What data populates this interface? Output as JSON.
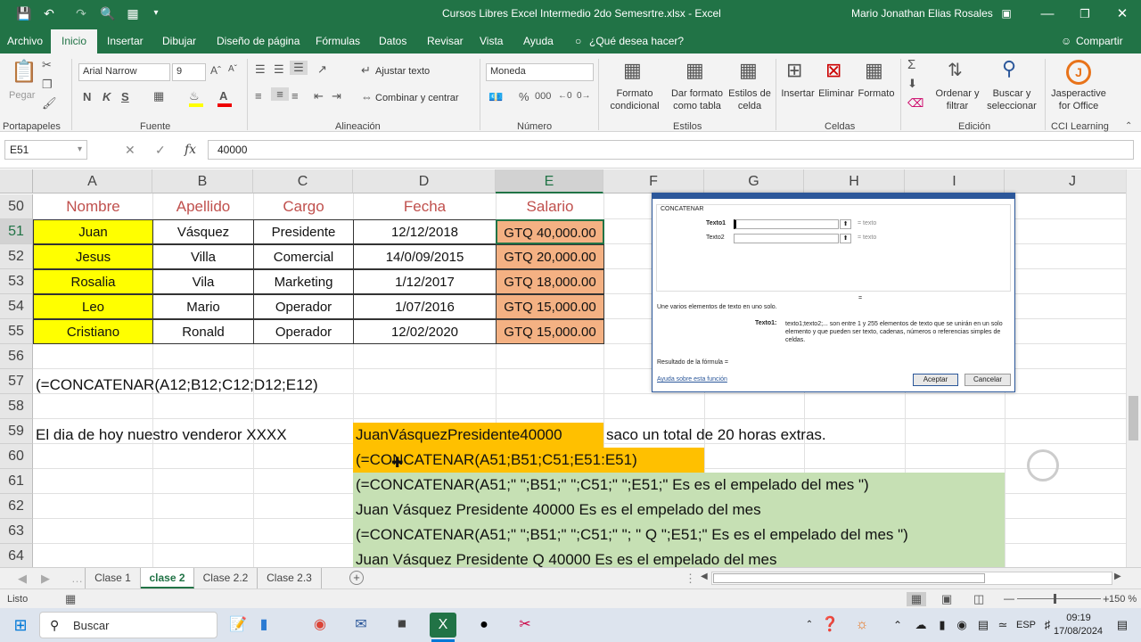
{
  "title_bar": {
    "file_title": "Cursos Libres Excel Intermedio 2do Semesrtre.xlsx  -  Excel",
    "user": "Mario Jonathan  Elias Rosales"
  },
  "tabs": [
    "Archivo",
    "Inicio",
    "Insertar",
    "Dibujar",
    "Diseño de página",
    "Fórmulas",
    "Datos",
    "Revisar",
    "Vista",
    "Ayuda"
  ],
  "tell_me": "¿Qué desea hacer?",
  "share": "Compartir",
  "ribbon": {
    "paste": "Pegar",
    "font_name": "Arial Narrow",
    "font_size": "9",
    "wrap_text": "Ajustar texto",
    "merge_center": "Combinar y centrar",
    "number_format": "Moneda",
    "cond_format": "Formato condicional",
    "format_table": "Dar formato como tabla",
    "cell_styles": "Estilos de celda",
    "insert": "Insertar",
    "delete": "Eliminar",
    "format": "Formato",
    "sort_filter": "Ordenar y filtrar",
    "find_select": "Buscar y seleccionar",
    "jasper": "Jasperactive for Office",
    "groups": [
      "Portapapeles",
      "Fuente",
      "Alineación",
      "Número",
      "Estilos",
      "Celdas",
      "Edición",
      "CCI Learning"
    ],
    "bold": "N",
    "italic": "K",
    "underline": "S"
  },
  "formula_bar": {
    "name_box": "E51",
    "fx": "fx",
    "content": "40000"
  },
  "columns": [
    "A",
    "B",
    "C",
    "D",
    "E",
    "F",
    "G",
    "H",
    "I",
    "J"
  ],
  "rows": [
    "50",
    "51",
    "52",
    "53",
    "54",
    "55",
    "56",
    "57",
    "58",
    "59",
    "60",
    "61",
    "62",
    "63",
    "64"
  ],
  "table": {
    "headers": [
      "Nombre",
      "Apellido",
      "Cargo",
      "Fecha",
      "Salario"
    ],
    "data": [
      [
        "Juan",
        "Vásquez",
        "Presidente",
        "12/12/2018",
        "GTQ 40,000.00"
      ],
      [
        "Jesus",
        "Villa",
        "Comercial",
        "14/0/09/2015",
        "GTQ 20,000.00"
      ],
      [
        "Rosalia",
        "Vila",
        "Marketing",
        "1/12/2017",
        "GTQ 18,000.00"
      ],
      [
        "Leo",
        "Mario",
        "Operador",
        "1/07/2016",
        "GTQ 15,000.00"
      ],
      [
        "Cristiano",
        "Ronald",
        "Operador",
        "12/02/2020",
        "GTQ 15,000.00"
      ]
    ]
  },
  "cells": {
    "r57": "(=CONCATENAR(A12;B12;C12;D12;E12)",
    "r59a": "El dia de hoy nuestro venderor XXXX",
    "r59d": "JuanVásquezPresidente40000",
    "r59f": "saco un total de 20 horas extras.",
    "r60d": "(=CONCATENAR(A51;B51;C51;E51:E51)",
    "r61": "(=CONCATENAR(A51;\" \";B51;\" \";C51;\" \";E51;\"  Es es el empelado del mes \")",
    "r62": "Juan Vásquez Presidente 40000  Es es el empelado del mes",
    "r63": "(=CONCATENAR(A51;\" \";B51;\" \";C51;\" \"; \" Q \";E51;\"  Es es el empelado del mes \")",
    "r64": "Juan Vásquez Presidente  Q 40000  Es es el empelado del mes"
  },
  "dialog": {
    "fn": "CONCATENAR",
    "t1": "Texto1",
    "t2": "Texto2",
    "eq1": "= texto",
    "eq2": "= texto",
    "mid_eq": "=",
    "desc": "Une varios elementos de texto en uno solo.",
    "arg_label": "Texto1:",
    "arg_desc": "texto1;texto2;... son entre 1 y 255 elementos de texto que se unirán en un solo elemento y que pueden ser texto, cadenas, números o referencias simples de celdas.",
    "result": "Resultado de la fórmula =",
    "help": "Ayuda sobre esta función",
    "ok": "Aceptar",
    "cancel": "Cancelar"
  },
  "sheets": [
    "Clase 1",
    "clase 2",
    "Clase 2.2",
    "Clase 2.3"
  ],
  "status": {
    "ready": "Listo",
    "zoom": "150 %"
  },
  "taskbar": {
    "search": "Buscar",
    "lang": "ESP",
    "time": "09:19",
    "date": "17/08/2024"
  }
}
